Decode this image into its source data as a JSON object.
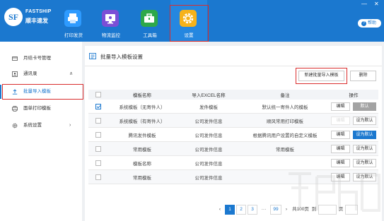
{
  "app": {
    "logo_letters": "SF",
    "logo_en": "FASTSHIP",
    "logo_cn": "顺丰速发",
    "help_label": "帮助",
    "window_controls": [
      "—",
      "✕"
    ]
  },
  "nav": [
    {
      "label": "打印发货",
      "icon": "printer-icon",
      "color": "#1e90ff"
    },
    {
      "label": "物流监控",
      "icon": "monitor-icon",
      "color": "#7b4fd6"
    },
    {
      "label": "工具箱",
      "icon": "toolbox-icon",
      "color": "#2ea84a"
    },
    {
      "label": "设置",
      "icon": "gear-icon",
      "color": "#f6b21a",
      "active": true
    }
  ],
  "sidebar": {
    "items": [
      {
        "label": "月结卡号管理",
        "icon": "card-icon"
      },
      {
        "label": "通讯录",
        "icon": "contacts-icon",
        "chevron": "∧"
      },
      {
        "label": "批量导入模板",
        "icon": "upload-icon",
        "selected": true
      },
      {
        "label": "面单打印模板",
        "icon": "print-template-icon"
      },
      {
        "label": "系统设置",
        "icon": "gear-icon",
        "chevron": "›"
      }
    ]
  },
  "main": {
    "title": "批量导入模板设置",
    "new_button": "新建批量导入模板",
    "delete_button": "删除",
    "columns": [
      "模板名称",
      "导入EXCEL名称",
      "备注",
      "操作"
    ],
    "rows": [
      {
        "checked": true,
        "name": "系统模板（无寄件人）",
        "file": "发件模板",
        "note": "默认统一寄件人的模板",
        "edit": "编辑",
        "default": "默认",
        "default_style": "grey"
      },
      {
        "checked": false,
        "name": "系统模板（有寄件人）",
        "file": "公司发件信息",
        "note": "顺风常用打印模板",
        "edit": "编辑",
        "edit_faded": true,
        "default": "设为默认",
        "default_style": "plain"
      },
      {
        "checked": false,
        "name": "腾讯发件模板",
        "file": "公司发件信息",
        "note": "根据腾讯用户设置的自定义模板",
        "edit": "编辑",
        "default": "设为默认",
        "default_style": "blue"
      },
      {
        "checked": false,
        "name": "常用模板",
        "file": "公司发件信息",
        "note": "常用模板",
        "edit": "编辑",
        "default": "设为默认",
        "default_style": "plain"
      },
      {
        "checked": false,
        "name": "模板名称",
        "file": "公司发件信息",
        "note": "",
        "edit": "编辑",
        "default": "设为默认",
        "default_style": "plain"
      },
      {
        "checked": false,
        "name": "常用模板",
        "file": "公司发件信息",
        "note": "",
        "edit": "编辑",
        "default": "设为默认",
        "default_style": "plain"
      }
    ]
  },
  "pager": {
    "prev": "‹",
    "pages": [
      "1",
      "2",
      "3",
      "···",
      "99"
    ],
    "next": "›",
    "total": "共100页",
    "goto": "到",
    "unit": "页",
    "confirm": "确认",
    "current": "1"
  }
}
